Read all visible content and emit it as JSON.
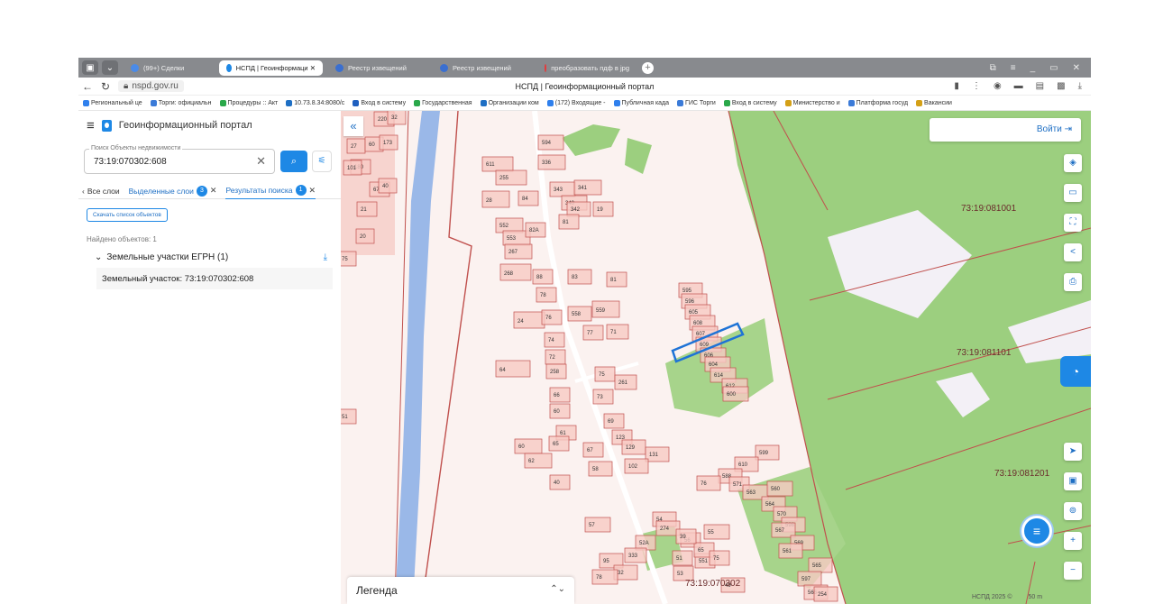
{
  "tabs": [
    {
      "label": "(99+) Сделки",
      "color": "#4b8be8",
      "active": false
    },
    {
      "label": "НСПД | Геоинформаци ✕",
      "color": "#1e88e5",
      "active": true
    },
    {
      "label": "Реестр извещений",
      "color": "#3a6fd0",
      "active": false
    },
    {
      "label": "Реестр извещений",
      "color": "#3a6fd0",
      "active": false
    },
    {
      "label": "преобразовать пдф в jpg",
      "color": "#e5393a",
      "active": false
    }
  ],
  "address": {
    "url": "nspd.gov.ru",
    "page_title": "НСПД | Геоинформационный портал"
  },
  "bookmarks": [
    {
      "label": "Региональный це",
      "color": "#2f80ed"
    },
    {
      "label": "Торги: официальн",
      "color": "#3b7bd8"
    },
    {
      "label": "Процедуры :: Акт",
      "color": "#2aa84a"
    },
    {
      "label": "10.73.8.34:8080/c",
      "color": "#1e6fc4"
    },
    {
      "label": "Вход в систему",
      "color": "#1f5fbf"
    },
    {
      "label": "Государственная",
      "color": "#2aa84a"
    },
    {
      "label": "Организации ком",
      "color": "#1e6fc4"
    },
    {
      "label": "(172) Входящие -",
      "color": "#2f80ed"
    },
    {
      "label": "Публичная када",
      "color": "#2f80ed"
    },
    {
      "label": "ГИС Торги",
      "color": "#3b7bd8"
    },
    {
      "label": "Вход в систему",
      "color": "#2aa84a"
    },
    {
      "label": "Министерство и",
      "color": "#d4a017"
    },
    {
      "label": "Платформа госуд",
      "color": "#3b7bd8"
    },
    {
      "label": "Вакансии",
      "color": "#d4a017"
    }
  ],
  "panel": {
    "app_title": "Геоинформационный портал",
    "search_label": "Поиск Объекты недвижимости",
    "search_value": "73:19:070302:608",
    "tab_all": "Все слои",
    "tab_selected": "Выделенные слои",
    "tab_selected_count": "3",
    "tab_results": "Результаты поиска",
    "tab_results_count": "1",
    "download_list": "Скачать список объектов",
    "found": "Найдено объектов: 1",
    "group_title": "Земельные участки ЕГРН (1)",
    "result_item": "Земельный участок: 73:19:070302:608"
  },
  "map": {
    "login": "Войти",
    "legend": "Легенда",
    "quarters": [
      "73:19:081001",
      "73:19:081101",
      "73:19:081201",
      "73:19:070302"
    ],
    "scale_copyright": "НСПД 2025 ©",
    "scale_value": "50 m",
    "parcel_numbers": [
      "611",
      "336",
      "594",
      "255",
      "343",
      "341",
      "340",
      "342",
      "19",
      "28",
      "84",
      "81",
      "552",
      "553",
      "82A",
      "267",
      "268",
      "88",
      "83",
      "81",
      "78",
      "558",
      "559",
      "24",
      "76",
      "77",
      "71",
      "74",
      "72",
      "64",
      "75",
      "258",
      "261",
      "73",
      "66",
      "60",
      "69",
      "61",
      "60",
      "62",
      "65",
      "67",
      "123",
      "129",
      "131",
      "102",
      "58",
      "40",
      "595",
      "596",
      "605",
      "608",
      "607",
      "609",
      "606",
      "604",
      "614",
      "612",
      "600",
      "599",
      "610",
      "588",
      "76",
      "571",
      "563",
      "560",
      "564",
      "570",
      "598",
      "567",
      "569",
      "561",
      "565",
      "597",
      "566",
      "254",
      "57",
      "54",
      "274",
      "55",
      "56",
      "52A",
      "333",
      "95",
      "32",
      "78",
      "551",
      "49",
      "53",
      "51",
      "65",
      "75",
      "39",
      "220",
      "32",
      "27",
      "60",
      "173",
      "180",
      "67",
      "40",
      "101",
      "21",
      "20",
      "75",
      "51"
    ],
    "highlighted_parcel": "608"
  },
  "colors": {
    "accent": "#1e88e5",
    "parcel_fill": "#f7c9c3",
    "parcel_stroke": "#c0504d",
    "forest": "#9ccf7f",
    "river": "#9ab8e8",
    "highlight": "#1e73d6"
  }
}
